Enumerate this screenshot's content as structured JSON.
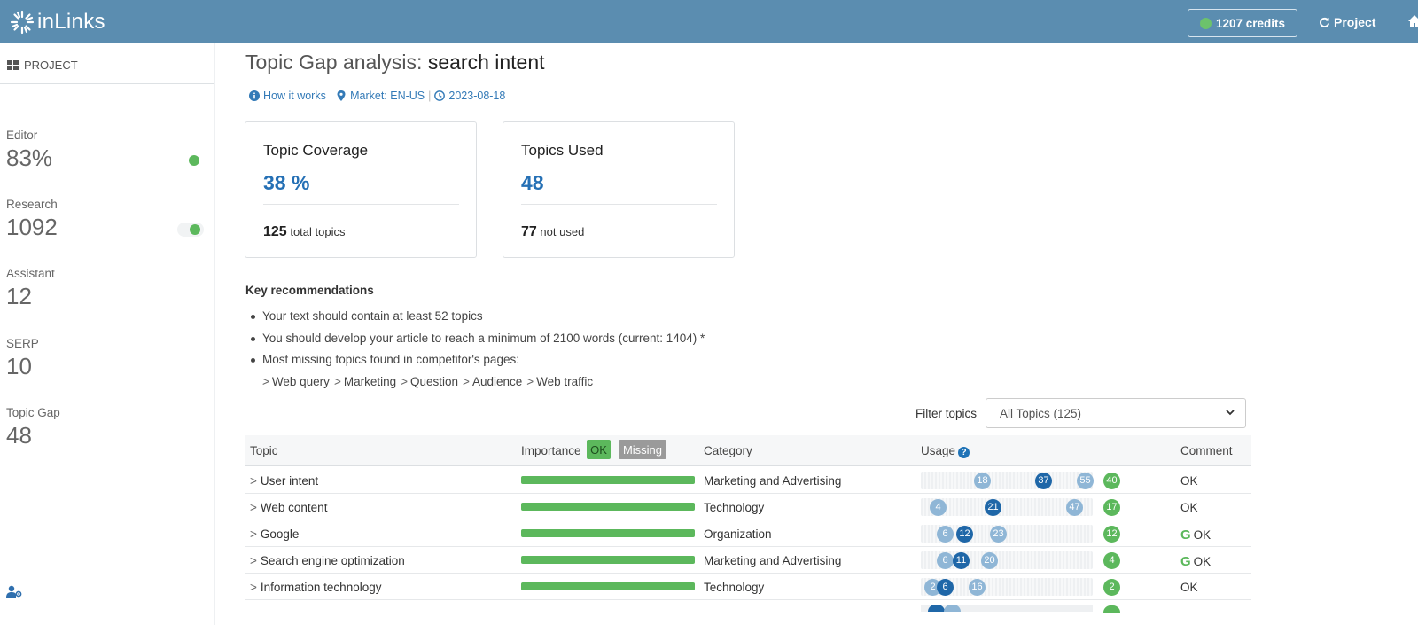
{
  "brand": {
    "name": "inLinks"
  },
  "header": {
    "credits": "1207 credits",
    "project_label": "Project"
  },
  "sidebar": {
    "section": "PROJECT",
    "stats": [
      {
        "label": "Editor",
        "value": "83%"
      },
      {
        "label": "Research",
        "value": "1092"
      },
      {
        "label": "Assistant",
        "value": "12"
      },
      {
        "label": "SERP",
        "value": "10"
      },
      {
        "label": "Topic Gap",
        "value": "48"
      }
    ]
  },
  "page": {
    "title_prefix": "Topic Gap analysis:",
    "title_keyword": "search intent",
    "meta": {
      "how": "How it works",
      "market": "Market: EN-US",
      "date": "2023-08-18"
    }
  },
  "cards": [
    {
      "title": "Topic Coverage",
      "value": "38 %",
      "foot_num": "125",
      "foot_text": "total topics"
    },
    {
      "title": "Topics Used",
      "value": "48",
      "foot_num": "77",
      "foot_text": "not used"
    }
  ],
  "recommendations": {
    "title": "Key recommendations",
    "items": [
      "Your text should contain at least 52 topics",
      "You should develop your article to reach a minimum of 2100 words (current: 1404) *",
      "Most missing topics found in competitor's pages:"
    ],
    "missing_topics": [
      "Web query",
      "Marketing",
      "Question",
      "Audience",
      "Web traffic"
    ]
  },
  "filter": {
    "label": "Filter topics",
    "selected": "All Topics (125)"
  },
  "table": {
    "headers": {
      "topic": "Topic",
      "importance": "Importance",
      "ok": "OK",
      "missing": "Missing",
      "category": "Category",
      "usage": "Usage",
      "comment": "Comment"
    },
    "rows": [
      {
        "topic": "User intent",
        "category": "Marketing and Advertising",
        "usage": [
          {
            "v": "18",
            "t": "light"
          },
          {
            "v": "37",
            "t": "dark"
          },
          {
            "v": "55",
            "t": "light"
          }
        ],
        "count": "40",
        "comment": "OK",
        "google": false
      },
      {
        "topic": "Web content",
        "category": "Technology",
        "usage": [
          {
            "v": "4",
            "t": "light"
          },
          {
            "v": "21",
            "t": "dark"
          },
          {
            "v": "47",
            "t": "light"
          }
        ],
        "count": "17",
        "comment": "OK",
        "google": false
      },
      {
        "topic": "Google",
        "category": "Organization",
        "usage": [
          {
            "v": "6",
            "t": "light"
          },
          {
            "v": "12",
            "t": "dark"
          },
          {
            "v": "23",
            "t": "light"
          }
        ],
        "count": "12",
        "comment": "OK",
        "google": true
      },
      {
        "topic": "Search engine optimization",
        "category": "Marketing and Advertising",
        "usage": [
          {
            "v": "6",
            "t": "light"
          },
          {
            "v": "11",
            "t": "dark"
          },
          {
            "v": "20",
            "t": "light"
          }
        ],
        "count": "4",
        "comment": "OK",
        "google": true
      },
      {
        "topic": "Information technology",
        "category": "Technology",
        "usage": [
          {
            "v": "2",
            "t": "light"
          },
          {
            "v": "6",
            "t": "dark"
          },
          {
            "v": "16",
            "t": "light"
          }
        ],
        "count": "2",
        "comment": "OK",
        "google": false
      }
    ]
  },
  "colors": {
    "topbar": "#5b8db0",
    "accent": "#2570b5",
    "ok_green": "#5cb85c",
    "usage_dark": "#1f67a8",
    "usage_light": "#8fb6d6"
  }
}
